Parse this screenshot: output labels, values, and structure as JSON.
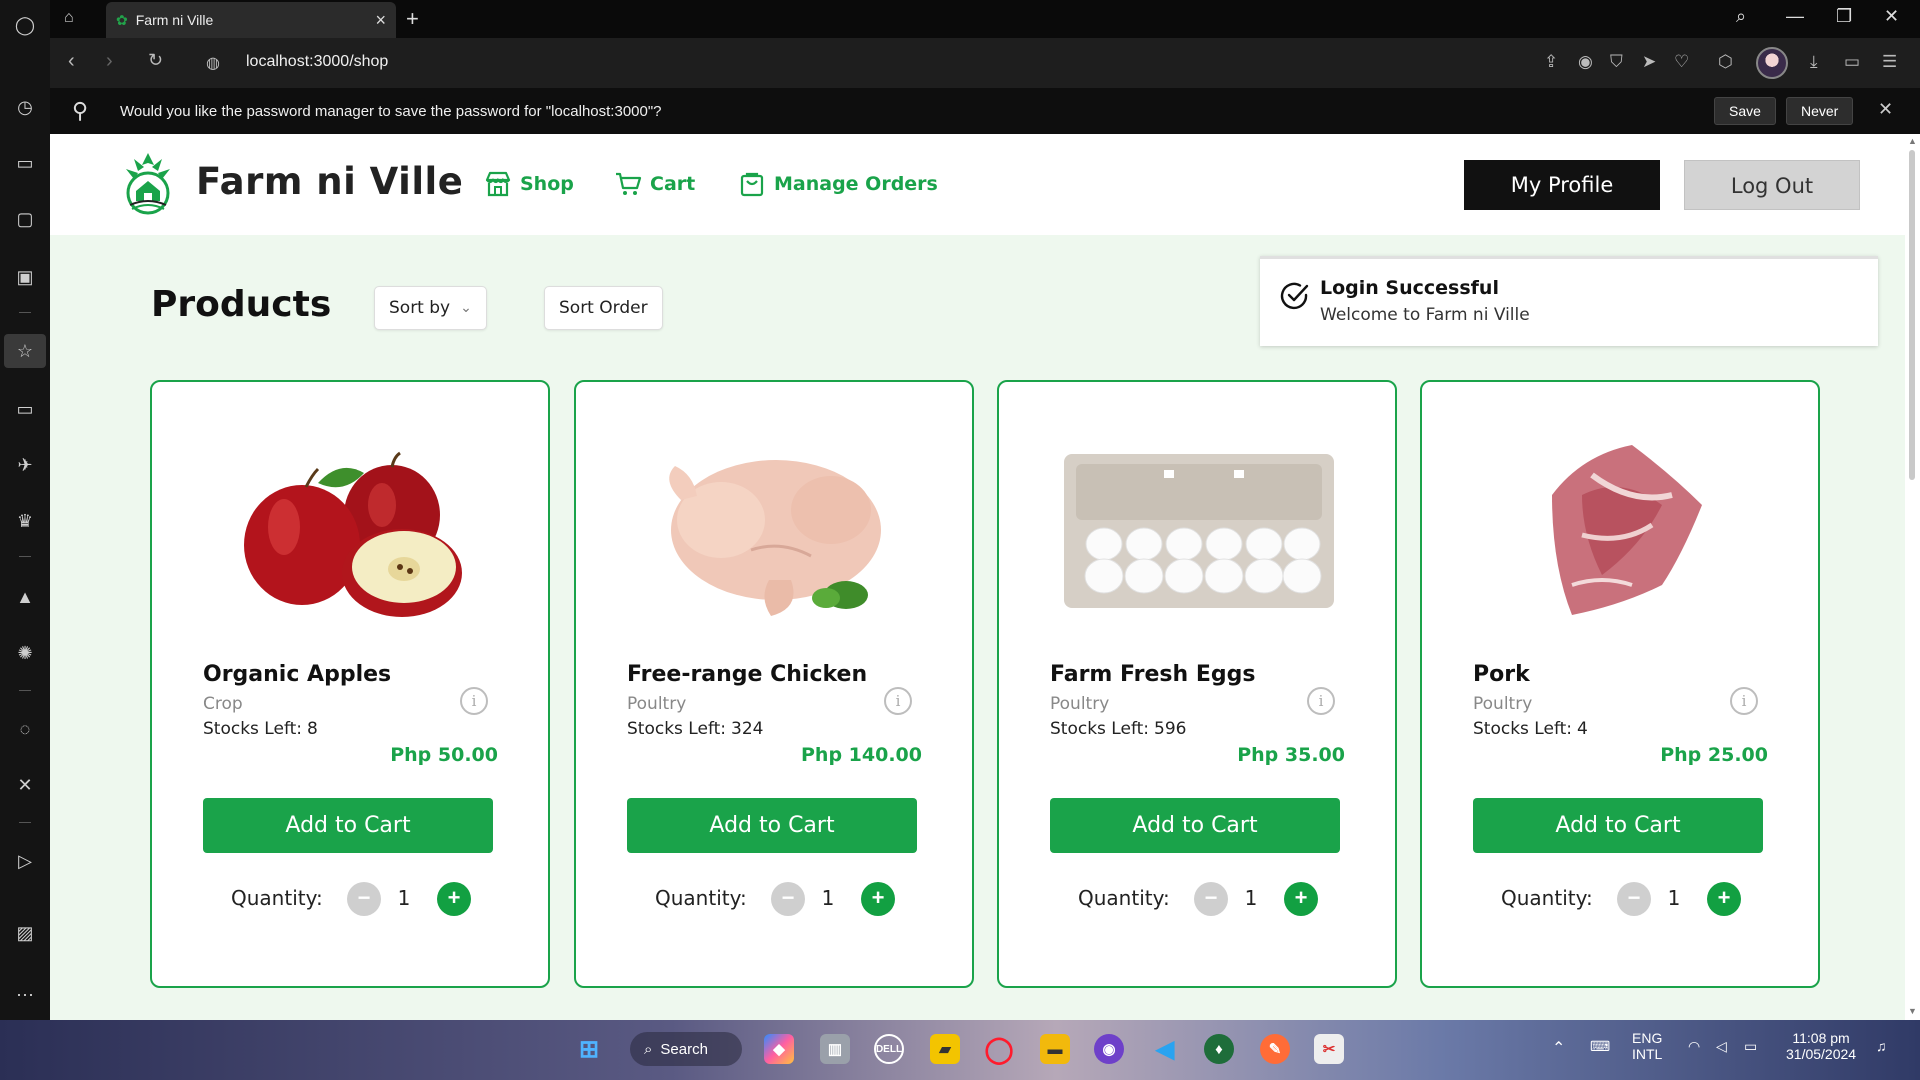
{
  "browser": {
    "tab_title": "Farm ni Ville",
    "url": "localhost:3000/shop",
    "password_prompt": "Would you like the password manager to save the password for \"localhost:3000\"?",
    "save_label": "Save",
    "never_label": "Never"
  },
  "header": {
    "brand": "Farm ni Ville",
    "nav": [
      {
        "label": "Shop",
        "icon": "store-icon"
      },
      {
        "label": "Cart",
        "icon": "cart-icon"
      },
      {
        "label": "Manage Orders",
        "icon": "bag-icon"
      }
    ],
    "profile_label": "My Profile",
    "logout_label": "Log Out"
  },
  "toolbar": {
    "title": "Products",
    "sort_by_label": "Sort by",
    "sort_order_label": "Sort Order"
  },
  "toast": {
    "title": "Login Successful",
    "message": "Welcome to Farm ni Ville"
  },
  "products": [
    {
      "name": "Organic Apples",
      "category": "Crop",
      "stock_label": "Stocks Left:",
      "stock": "8",
      "price": "Php 50.00",
      "add_label": "Add to Cart",
      "qty_label": "Quantity:",
      "qty": "1",
      "image": "apples"
    },
    {
      "name": "Free-range Chicken",
      "category": "Poultry",
      "stock_label": "Stocks Left:",
      "stock": "324",
      "price": "Php 140.00",
      "add_label": "Add to Cart",
      "qty_label": "Quantity:",
      "qty": "1",
      "image": "chicken"
    },
    {
      "name": "Farm Fresh Eggs",
      "category": "Poultry",
      "stock_label": "Stocks Left:",
      "stock": "596",
      "price": "Php 35.00",
      "add_label": "Add to Cart",
      "qty_label": "Quantity:",
      "qty": "1",
      "image": "eggs"
    },
    {
      "name": "Pork",
      "category": "Poultry",
      "stock_label": "Stocks Left:",
      "stock": "4",
      "price": "Php 25.00",
      "add_label": "Add to Cart",
      "qty_label": "Quantity:",
      "qty": "1",
      "image": "pork"
    }
  ],
  "taskbar": {
    "search_label": "Search",
    "lang_top": "ENG",
    "lang_bottom": "INTL",
    "time": "11:08 pm",
    "date": "31/05/2024"
  },
  "colors": {
    "brand_green": "#1aa34a",
    "page_bg": "#eef8ee",
    "profile_bg": "#111111",
    "logout_bg": "#d3d3d3"
  }
}
